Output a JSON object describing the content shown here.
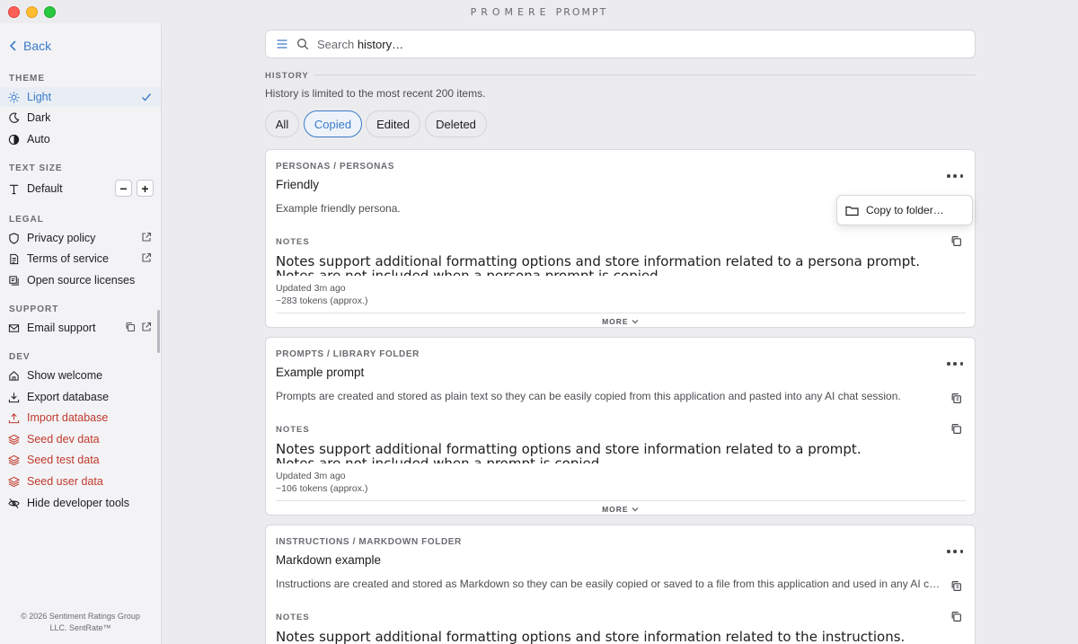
{
  "window": {
    "title_a": "PROMERE",
    "title_b": "PROMPT"
  },
  "sidebar": {
    "back_label": "Back",
    "theme": {
      "label": "THEME",
      "items": [
        "Light",
        "Dark",
        "Auto"
      ]
    },
    "text_size": {
      "label": "TEXT SIZE",
      "value": "Default",
      "minus": "−",
      "plus": "+"
    },
    "legal": {
      "label": "LEGAL",
      "items": [
        "Privacy policy",
        "Terms of service",
        "Open source licenses"
      ]
    },
    "support": {
      "label": "SUPPORT",
      "items": [
        "Email support"
      ]
    },
    "dev": {
      "label": "DEV",
      "items": [
        "Show welcome",
        "Export database",
        "Import database",
        "Seed dev data",
        "Seed test data",
        "Seed user data",
        "Hide developer tools"
      ]
    },
    "copyright_line1": "© 2026 Sentiment Ratings Group",
    "copyright_line2": "LLC. SentRate™"
  },
  "search": {
    "prefix": "Search ",
    "term": "history…"
  },
  "history": {
    "label": "HISTORY",
    "note": "History is limited to the most recent 200 items.",
    "filters": [
      "All",
      "Copied",
      "Edited",
      "Deleted"
    ],
    "selected_filter": "Copied"
  },
  "cards": [
    {
      "path": "PERSONAS / PERSONAS",
      "title": "Friendly",
      "description": "Example friendly persona.",
      "notes_label": "NOTES",
      "notes_line1": "Notes support additional formatting options and store information related to a persona prompt.",
      "notes_line2": "Notes are not included when a persona prompt is copied.",
      "updated": "Updated 3m ago",
      "tokens": "~283 tokens (approx.)",
      "more": "MORE"
    },
    {
      "path": "PROMPTS / LIBRARY FOLDER",
      "title": "Example prompt",
      "description": "Prompts are created and stored as plain text so they can be easily copied from this application and pasted into any AI chat session.",
      "notes_label": "NOTES",
      "notes_line1": "Notes support additional formatting options and store information related to a prompt.",
      "notes_line2": "Notes are not included when a prompt is copied.",
      "updated": "Updated 3m ago",
      "tokens": "~106 tokens (approx.)",
      "more": "MORE"
    },
    {
      "path": "INSTRUCTIONS / MARKDOWN FOLDER",
      "title": "Markdown example",
      "description": "Instructions are created and stored as Markdown so they can be easily copied or saved to a file from this application and used in any AI chat session.",
      "notes_label": "NOTES",
      "notes_line1": "Notes support additional formatting options and store information related to the instructions."
    }
  ],
  "dropdown": {
    "copy_to_folder": "Copy to folder…"
  },
  "colors": {
    "accent": "#3a7bc8",
    "danger": "#c0392b"
  }
}
